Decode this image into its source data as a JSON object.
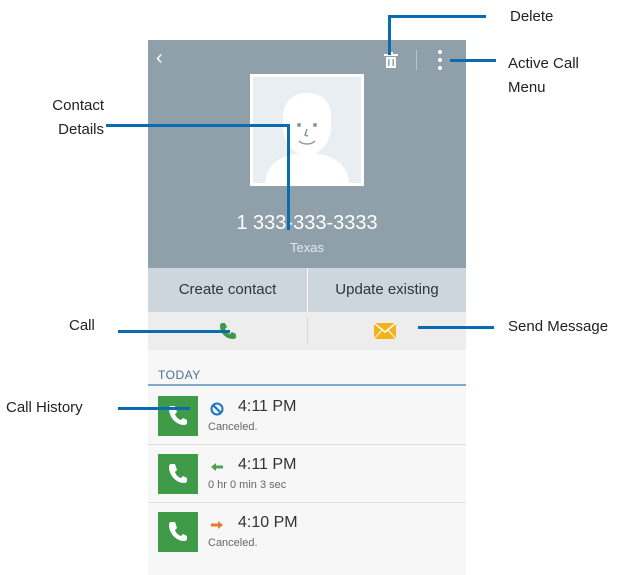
{
  "phone": {
    "number": "1 333-333-3333",
    "location": "Texas",
    "actions": {
      "create": "Create contact",
      "update": "Update existing"
    },
    "history": {
      "section_title": "TODAY",
      "entries": [
        {
          "time": "4:11 PM",
          "detail": "Canceled.",
          "type": "canceled"
        },
        {
          "time": "4:11 PM",
          "detail": "0 hr 0 min 3 sec",
          "type": "incoming"
        },
        {
          "time": "4:10 PM",
          "detail": "Canceled.",
          "type": "outgoing"
        }
      ]
    }
  },
  "callouts": {
    "delete": "Delete",
    "menu": "Active Call Menu",
    "details": "Contact Details",
    "call": "Call",
    "send": "Send Message",
    "history": "Call History"
  },
  "icons": [
    "back-icon",
    "trash-icon",
    "overflow-menu-icon",
    "contact-avatar-icon",
    "phone-icon",
    "envelope-icon"
  ],
  "colors": {
    "header": "#8fa0ab",
    "actions_bar": "#ccd6dc",
    "call_green": "#3f9b47",
    "message_orange": "#f6b21b",
    "callout_blue": "#0a6bb1"
  }
}
